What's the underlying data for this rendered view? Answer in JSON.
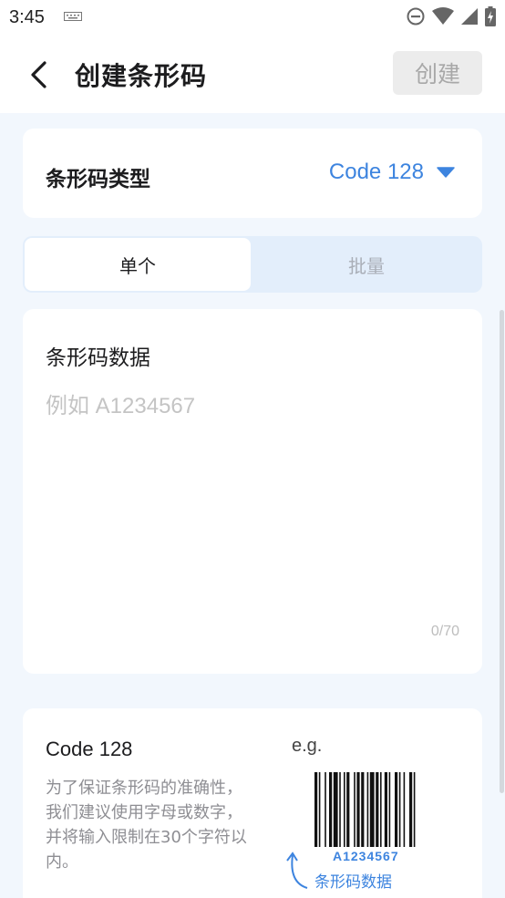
{
  "status_bar": {
    "time": "3:45"
  },
  "app_bar": {
    "title": "创建条形码",
    "create_label": "创建"
  },
  "barcode_type": {
    "label": "条形码类型",
    "value": "Code 128"
  },
  "mode_tabs": [
    {
      "label": "单个",
      "active": true
    },
    {
      "label": "批量",
      "active": false
    }
  ],
  "data_field": {
    "label": "条形码数据",
    "value": "",
    "placeholder": "例如 A1234567",
    "counter": "0/70"
  },
  "info": {
    "title": "Code 128",
    "description": "为了保证条形码的准确性，我们建议使用字母或数字，并将输入限制在30个字符以内。",
    "example_label": "e.g.",
    "example_value": "A1234567",
    "example_caption": "条形码数据"
  },
  "colors": {
    "accent": "#3d84df",
    "background": "#f2f7fd",
    "tab_track": "#e3eefb",
    "disabled_button": "#ececec"
  }
}
